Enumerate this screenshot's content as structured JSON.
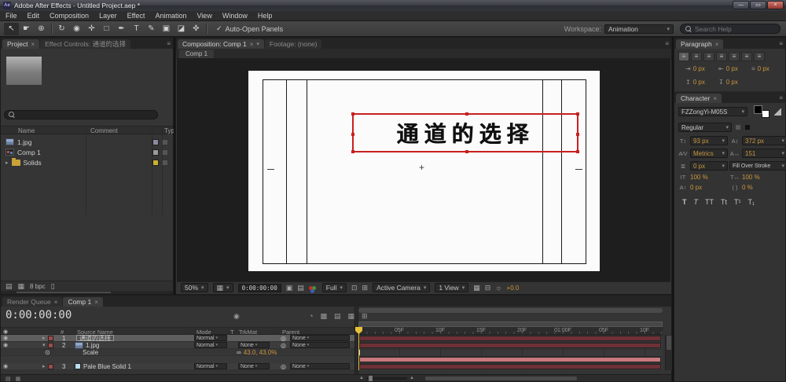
{
  "icons": {
    "app": "Ae",
    "tools": [
      "↖",
      "☛",
      "⊕",
      "↻",
      "◉",
      "✛",
      "□",
      "✒",
      "T",
      "✎",
      "▣",
      "◪",
      "✜"
    ]
  },
  "titlebar": {
    "title": "Adobe After Effects - Untitled Project.aep *"
  },
  "menubar": {
    "items": [
      "File",
      "Edit",
      "Composition",
      "Layer",
      "Effect",
      "Animation",
      "View",
      "Window",
      "Help"
    ]
  },
  "toolbar": {
    "auto_open_panels": "Auto-Open Panels",
    "workspace_label": "Workspace:",
    "workspace_value": "Animation",
    "search_placeholder": "Search Help"
  },
  "project_panel": {
    "tab": "Project",
    "effect_controls_tab": "Effect Controls: 通道的选择",
    "columns": {
      "name": "Name",
      "comment": "Comment",
      "type": "Type"
    },
    "items": [
      {
        "name": "1.jpg"
      },
      {
        "name": "Comp 1"
      },
      {
        "name": "Solids"
      }
    ],
    "bit_depth": "8 bpc"
  },
  "comp_panel": {
    "tab": "Composition: Comp 1",
    "footage_tab": "Footage: (none)",
    "subtab": "Comp 1",
    "canvas_text": "通道的选择",
    "footer": {
      "zoom": "50%",
      "timecode": "0:00:00:00",
      "resolution": "Full",
      "camera": "Active Camera",
      "views": "1 View",
      "exposure": "+0.0"
    }
  },
  "paragraph_panel": {
    "title": "Paragraph",
    "values": [
      "0 px",
      "0 px",
      "0 px",
      "0 px",
      "0 px"
    ]
  },
  "character_panel": {
    "title": "Character",
    "font_family": "FZZongYi-M05S",
    "font_style": "Regular",
    "font_size": "93 px",
    "leading": "372 px",
    "kerning": "Metrics",
    "tracking": "151",
    "stroke_width": "0 px",
    "stroke_mode": "Fill Over Stroke",
    "vertical_scale": "100 %",
    "horizontal_scale": "100 %",
    "baseline_shift": "0 px",
    "tsume": "0 %",
    "style_buttons": [
      "T",
      "T",
      "TT",
      "Tt",
      "T¹",
      "T₁"
    ]
  },
  "timeline_panel": {
    "render_queue_tab": "Render Queue",
    "comp_tab": "Comp 1",
    "timecode": "0:00:00:00",
    "columns": {
      "source_name": "Source Name",
      "mode": "Mode",
      "t": "T",
      "trkmat": "TrkMat",
      "parent": "Parent"
    },
    "layers": [
      {
        "num": "1",
        "name": "通道的选择",
        "mode": "Normal",
        "parent": "None"
      },
      {
        "num": "2",
        "name": "1.jpg",
        "mode": "Normal",
        "trkmat": "None",
        "parent": "None"
      },
      {
        "num": "3",
        "name": "Pale Blue Solid 1",
        "mode": "Normal",
        "trkmat": "None",
        "parent": "None"
      }
    ],
    "property": {
      "name": "Scale",
      "value": "43.0, 43.0%"
    },
    "ruler_labels": [
      "05F",
      "10F",
      "15F",
      "20F",
      "01:00F",
      "05F",
      "10F"
    ]
  },
  "colors": {
    "selection_red": "#c82020",
    "layer_bar": "#6d3036",
    "layer_bar_light": "#c9797d",
    "value_orange": "#c9953d",
    "cti_yellow": "#e8c33a"
  }
}
